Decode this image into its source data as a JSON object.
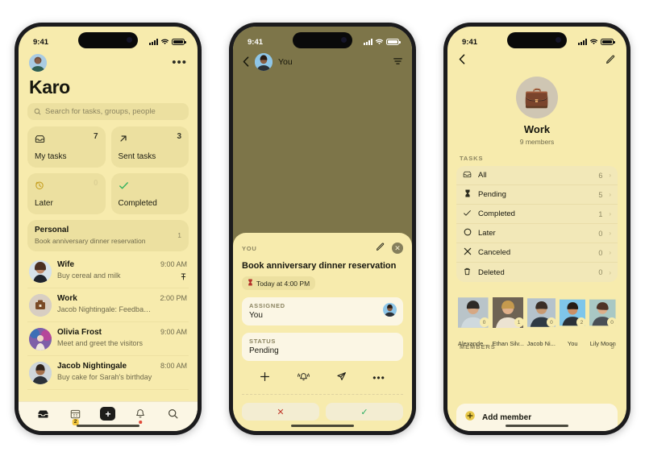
{
  "phone1": {
    "status": {
      "time": "9:41",
      "signal_icon": "cellular-bars-icon",
      "wifi_icon": "wifi-icon",
      "battery_icon": "battery-icon"
    },
    "header": {
      "avatar": "user-avatar",
      "more_icon": "more-horizontal-icon",
      "title": "Karo"
    },
    "search": {
      "placeholder": "Search for tasks, groups, people",
      "icon": "search-icon"
    },
    "tiles": [
      {
        "icon": "inbox-icon",
        "label": "My tasks",
        "count": "7"
      },
      {
        "icon": "arrow-up-right-icon",
        "label": "Sent tasks",
        "count": "3"
      },
      {
        "icon": "clock-history-icon",
        "label": "Later",
        "count": "0"
      },
      {
        "icon": "check-icon",
        "label": "Completed",
        "count": ""
      }
    ],
    "group_card": {
      "name": "Personal",
      "subtitle": "Book anniversary dinner reservation",
      "count": "1"
    },
    "rows": [
      {
        "name": "Wife",
        "subtitle": "Buy cereal and milk",
        "time": "9:00 AM",
        "pin": "pin-icon"
      },
      {
        "name": "Work",
        "subtitle": "Jacob Nightingale: Feedback on sales rep...",
        "time": "2:00 PM",
        "pin": ""
      },
      {
        "name": "Olivia Frost",
        "subtitle": "Meet and greet the visitors",
        "time": "9:00 AM",
        "pin": ""
      },
      {
        "name": "Jacob Nightingale",
        "subtitle": "Buy cake for Sarah's birthday",
        "time": "8:00 AM",
        "pin": ""
      }
    ],
    "tabs": [
      {
        "icon": "inbox-icon",
        "badge": "",
        "dot": false
      },
      {
        "icon": "calendar-icon",
        "badge": "2",
        "dot": false
      },
      {
        "icon": "plus-icon",
        "badge": "",
        "dot": false
      },
      {
        "icon": "bell-icon",
        "badge": "",
        "dot": true
      },
      {
        "icon": "search-icon",
        "badge": "",
        "dot": false
      }
    ]
  },
  "phone2": {
    "status": {
      "time": "9:41"
    },
    "header": {
      "back_icon": "chevron-left-icon",
      "avatar": "user-avatar",
      "title": "You",
      "filter_icon": "filter-icon"
    },
    "sheet": {
      "eyebrow": "YOU",
      "edit_icon": "pencil-icon",
      "close_icon": "close-icon",
      "title": "Book anniversary dinner reservation",
      "due_chip": {
        "icon": "hourglass-icon",
        "text": "Today at 4:00 PM"
      },
      "assigned": {
        "label": "ASSIGNED",
        "value": "You",
        "avatar": "user-avatar"
      },
      "status": {
        "label": "STATUS",
        "value": "Pending"
      },
      "actions": [
        {
          "icon": "plus-icon"
        },
        {
          "icon": "bell-ring-icon"
        },
        {
          "icon": "send-icon"
        },
        {
          "icon": "more-horizontal-icon"
        }
      ],
      "decline_label": "✕",
      "accept_label": "✓"
    }
  },
  "phone3": {
    "status": {
      "time": "9:41"
    },
    "header": {
      "back_icon": "chevron-left-icon",
      "edit_icon": "pencil-icon"
    },
    "group": {
      "emoji": "💼",
      "name": "Work",
      "members_text": "9 members"
    },
    "tasks_label": "TASKS",
    "tasks": [
      {
        "icon": "inbox-icon",
        "label": "All",
        "count": "6"
      },
      {
        "icon": "hourglass-icon",
        "label": "Pending",
        "count": "5"
      },
      {
        "icon": "check-icon",
        "label": "Completed",
        "count": "1"
      },
      {
        "icon": "circle-icon",
        "label": "Later",
        "count": "0"
      },
      {
        "icon": "close-icon",
        "label": "Canceled",
        "count": "0"
      },
      {
        "icon": "trash-icon",
        "label": "Deleted",
        "count": "0"
      }
    ],
    "people": [
      {
        "name": "Alexande...",
        "badge": "0"
      },
      {
        "name": "Ethan Silv...",
        "badge": "1"
      },
      {
        "name": "Jacob Ni...",
        "badge": "0"
      },
      {
        "name": "You",
        "badge": "2"
      },
      {
        "name": "Lily Moon",
        "badge": "0"
      }
    ],
    "members": {
      "label": "MEMBERS",
      "count": "9"
    },
    "add_member": {
      "label": "Add member",
      "icon": "plus-circle-icon"
    }
  },
  "colors": {
    "page_bg": "#f7ebad",
    "card_bg": "#ece0a0",
    "surface": "#fbf6e4",
    "dim_overlay": "#7d7549",
    "accent_badge": "#f2c53d",
    "danger": "#c0392b",
    "success": "#27ae60"
  }
}
